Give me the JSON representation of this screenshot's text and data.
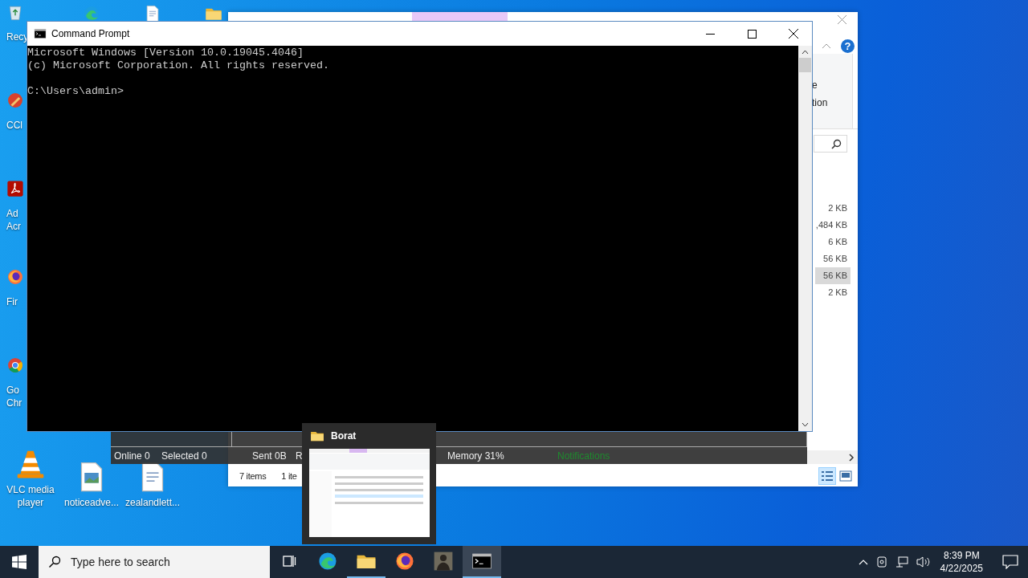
{
  "desktop": {
    "icon_columns": [
      [
        {
          "kind": "recycle-bin",
          "label": "Recy"
        },
        {
          "kind": "ccleaner",
          "label": "CCl"
        },
        {
          "kind": "acrobat",
          "label": "Ad Acr"
        },
        {
          "kind": "firefox",
          "label": "Fir"
        },
        {
          "kind": "chrome",
          "label": "Go Chr"
        },
        {
          "kind": "vlc",
          "label": "VLC media player"
        }
      ],
      [
        {
          "kind": "edge"
        },
        {
          "kind": "image-file",
          "label": "noticeadve..."
        }
      ],
      [
        {
          "kind": "document"
        },
        {
          "kind": "document",
          "label": "zealandlett..."
        }
      ],
      [
        {
          "kind": "folder"
        }
      ]
    ]
  },
  "explorer": {
    "help_label": "?",
    "ribbon_texts": [
      "e",
      "tion"
    ],
    "sizes": [
      {
        "text": "2 KB",
        "selected": false
      },
      {
        "text": ",484 KB",
        "selected": false
      },
      {
        "text": "6 KB",
        "selected": false
      },
      {
        "text": "56 KB",
        "selected": false
      },
      {
        "text": "56 KB",
        "selected": true
      },
      {
        "text": "2 KB",
        "selected": false
      }
    ],
    "status": [
      "7 items",
      "1 ite"
    ],
    "view_buttons": [
      {
        "kind": "details",
        "selected": true
      },
      {
        "kind": "preview",
        "selected": false
      }
    ]
  },
  "command_prompt": {
    "title": "Command Prompt",
    "output": [
      [
        "Microsoft Windows [Version 10.0.19045.4046]",
        "(c) Microsoft Corporation. All rights reserved."
      ],
      [
        "C:\\Users\\admin>"
      ]
    ]
  },
  "stats_bar": {
    "items": [
      {
        "text": "Online 0",
        "kind": "normal"
      },
      {
        "text": "Selected 0",
        "kind": "normal"
      },
      {
        "text": "Sent 0B",
        "kind": "normal"
      },
      {
        "text": "R",
        "kind": "normal"
      },
      {
        "text": "Memory 31%",
        "kind": "normal"
      },
      {
        "text": "Notifications",
        "kind": "notice"
      }
    ]
  },
  "thumbnail": {
    "title": "Borat"
  },
  "taskbar": {
    "search": {
      "placeholder": "Type here to search"
    },
    "apps": [
      {
        "kind": "task-view",
        "running": false,
        "selected": false
      },
      {
        "kind": "edge",
        "running": false,
        "selected": false
      },
      {
        "kind": "folder",
        "running": true,
        "selected": false
      },
      {
        "kind": "firefox",
        "running": false,
        "selected": false
      },
      {
        "kind": "person",
        "running": false,
        "selected": false
      },
      {
        "kind": "terminal",
        "running": true,
        "selected": true
      }
    ],
    "time": "8:39 PM",
    "date": "4/22/2025"
  }
}
